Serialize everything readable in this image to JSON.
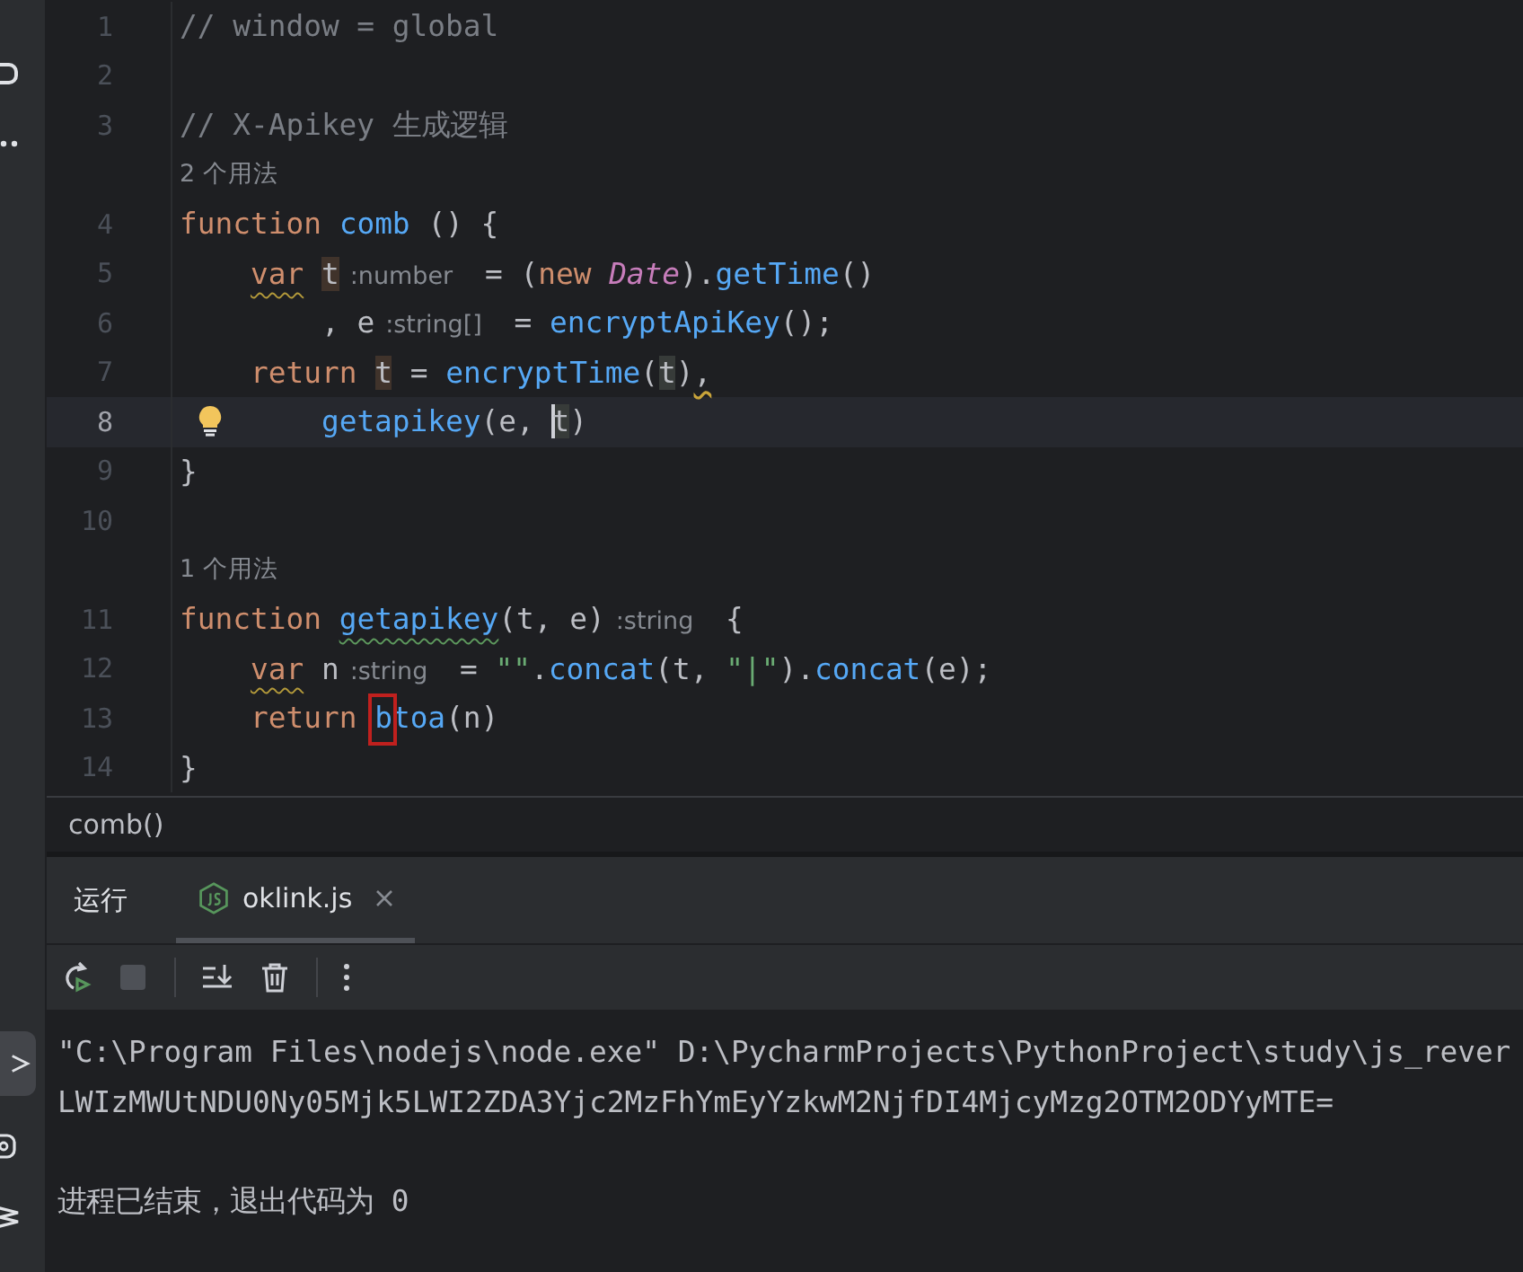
{
  "editor": {
    "lines": [
      {
        "kind": "code",
        "number": "1",
        "current": false,
        "tokens": [
          {
            "kind": "comment",
            "text": "// window = global"
          }
        ]
      },
      {
        "kind": "code",
        "number": "2",
        "current": false
      },
      {
        "kind": "code",
        "number": "3",
        "current": false,
        "tokens": [
          {
            "kind": "comment",
            "text": "// X-Apikey 生成逻辑"
          }
        ]
      },
      {
        "kind": "usage",
        "text": "2 个用法"
      },
      {
        "kind": "code",
        "number": "4",
        "current": false,
        "tokens": [
          {
            "kind": "keyword",
            "text": "function"
          },
          {
            "kind": "function",
            "text": " comb"
          },
          {
            "kind": "plain",
            "text": " () {"
          }
        ]
      },
      {
        "kind": "code",
        "number": "5",
        "current": false,
        "tokens": [
          {
            "kind": "keyword-warn",
            "text": "    var"
          },
          {
            "kind": "write-ref",
            "text": " t"
          },
          {
            "kind": "hint",
            "text": ":number"
          },
          {
            "kind": "plain",
            "text": " = ("
          },
          {
            "kind": "keyword",
            "text": "new"
          },
          {
            "kind": "class",
            "text": " Date"
          },
          {
            "kind": "plain",
            "text": ")."
          },
          {
            "kind": "function",
            "text": "getTime"
          },
          {
            "kind": "plain",
            "text": "()"
          }
        ]
      },
      {
        "kind": "code",
        "number": "6",
        "current": false,
        "tokens": [
          {
            "kind": "plain",
            "text": "        , e"
          },
          {
            "kind": "hint",
            "text": ":string[]"
          },
          {
            "kind": "plain",
            "text": " = "
          },
          {
            "kind": "function",
            "text": "encryptApiKey"
          },
          {
            "kind": "plain",
            "text": "();"
          }
        ]
      },
      {
        "kind": "code",
        "number": "7",
        "current": false,
        "tokens": [
          {
            "kind": "keyword",
            "text": "    return"
          },
          {
            "kind": "write-ref",
            "text": " t"
          },
          {
            "kind": "plain",
            "text": " = "
          },
          {
            "kind": "function",
            "text": "encryptTime"
          },
          {
            "kind": "plain",
            "text": "("
          },
          {
            "kind": "read-ref",
            "text": "t"
          },
          {
            "kind": "plain",
            "text": ")"
          },
          {
            "kind": "punct-warn",
            "text": ","
          }
        ]
      },
      {
        "kind": "code",
        "number": "8",
        "current": true,
        "tokens": [
          {
            "kind": "function",
            "text": "        getapikey"
          },
          {
            "kind": "plain",
            "text": "(e, "
          },
          {
            "kind": "caret-ref",
            "text": "t"
          },
          {
            "kind": "plain",
            "text": ")"
          }
        ]
      },
      {
        "kind": "code",
        "number": "9",
        "current": false,
        "tokens": [
          {
            "kind": "plain",
            "text": "}"
          }
        ]
      },
      {
        "kind": "code",
        "number": "10",
        "current": false
      },
      {
        "kind": "usage",
        "text": "1 个用法"
      },
      {
        "kind": "code",
        "number": "11",
        "current": false,
        "tokens": [
          {
            "kind": "keyword",
            "text": "function"
          },
          {
            "kind": "function-typo",
            "text": " getapikey"
          },
          {
            "kind": "plain",
            "text": "(t, e)"
          },
          {
            "kind": "hint",
            "text": ":string"
          },
          {
            "kind": "plain",
            "text": " {"
          }
        ]
      },
      {
        "kind": "code",
        "number": "12",
        "current": false,
        "tokens": [
          {
            "kind": "keyword-warn",
            "text": "    var"
          },
          {
            "kind": "plain",
            "text": " n"
          },
          {
            "kind": "hint",
            "text": ":string"
          },
          {
            "kind": "plain",
            "text": " = "
          },
          {
            "kind": "string",
            "text": "\"\""
          },
          {
            "kind": "plain",
            "text": "."
          },
          {
            "kind": "function",
            "text": "concat"
          },
          {
            "kind": "plain",
            "text": "(t, "
          },
          {
            "kind": "string",
            "text": "\"|\""
          },
          {
            "kind": "plain",
            "text": ")."
          },
          {
            "kind": "function",
            "text": "concat"
          },
          {
            "kind": "plain",
            "text": "(e);"
          }
        ]
      },
      {
        "kind": "code",
        "number": "13",
        "current": false,
        "tokens": [
          {
            "kind": "keyword",
            "text": "    return"
          },
          {
            "kind": "function-framed",
            "text": " btoa"
          },
          {
            "kind": "plain",
            "text": "(n)"
          }
        ]
      },
      {
        "kind": "code",
        "number": "14",
        "current": false,
        "tokens": [
          {
            "kind": "plain",
            "text": "}"
          }
        ]
      }
    ]
  },
  "breadcrumb": "comb()",
  "run_panel": {
    "title": "运行",
    "tabs": [
      {
        "label": "oklink.js",
        "selected": true
      }
    ],
    "console": [
      {
        "kind": "command",
        "text": "\"C:\\Program Files\\nodejs\\node.exe\" D:\\PycharmProjects\\PythonProject\\study\\js_rever"
      },
      {
        "kind": "output",
        "text": "LWIzMWUtNDU0Ny05Mjk5LWI2ZDA3Yjc2MzFhYmEyYzkwM2NjfDI4MjcyMzg2OTM2ODYyMTE="
      },
      {
        "kind": "exit",
        "text": "进程已结束，退出代码为 0"
      }
    ]
  }
}
